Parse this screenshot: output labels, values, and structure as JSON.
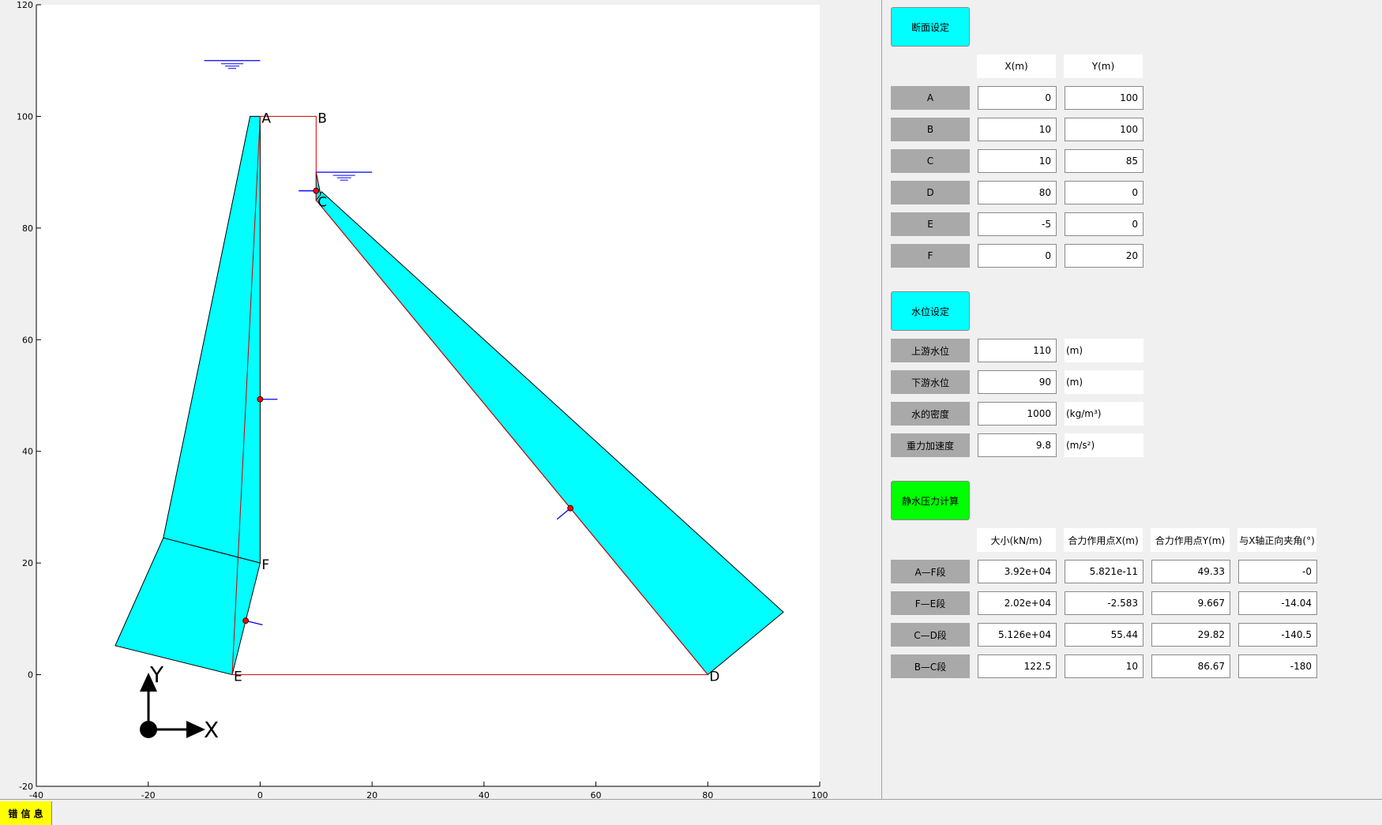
{
  "chart_data": {
    "type": "diagram",
    "xlim": [
      -40,
      100
    ],
    "ylim": [
      -20,
      120
    ],
    "x_ticks": [
      "-40",
      "-20",
      "0",
      "20",
      "40",
      "60",
      "80",
      "100"
    ],
    "y_ticks": [
      "-20",
      "0",
      "20",
      "40",
      "60",
      "80",
      "100",
      "120"
    ],
    "grid": false,
    "point_labels": [
      {
        "name": "A",
        "x": 0,
        "y": 100
      },
      {
        "name": "B",
        "x": 10,
        "y": 100
      },
      {
        "name": "C",
        "x": 10,
        "y": 85
      },
      {
        "name": "D",
        "x": 80,
        "y": 0
      },
      {
        "name": "E",
        "x": -5,
        "y": 0
      },
      {
        "name": "F",
        "x": 0,
        "y": 20
      }
    ],
    "outline": [
      [
        -5,
        0
      ],
      [
        80,
        0
      ],
      [
        10,
        85
      ],
      [
        10,
        100
      ],
      [
        0,
        100
      ]
    ],
    "pressure_polygons": [
      {
        "segment": "A—F",
        "points": [
          [
            -1.8,
            100
          ],
          [
            0,
            100
          ],
          [
            0,
            20
          ],
          [
            -17.3,
            24.5
          ]
        ]
      },
      {
        "segment": "F—E",
        "points": [
          [
            -17.3,
            24.5
          ],
          [
            0,
            20
          ],
          [
            -5,
            0
          ],
          [
            -25.9,
            5.2
          ]
        ]
      },
      {
        "segment": "C—D",
        "points": [
          [
            10,
            85
          ],
          [
            80,
            0
          ],
          [
            93.5,
            11.2
          ],
          [
            11,
            86.5
          ]
        ]
      },
      {
        "segment": "B—C",
        "points": [
          [
            10,
            90
          ],
          [
            10,
            85
          ],
          [
            10.8,
            86
          ]
        ]
      }
    ],
    "water_levels": [
      {
        "x_start": -10,
        "x_end": 0,
        "y": 110
      },
      {
        "x_start": 10,
        "x_end": 20,
        "y": 90
      }
    ],
    "resultants": [
      {
        "segment": "A—F",
        "x": 0,
        "y": 49.33,
        "angle": 0
      },
      {
        "segment": "F—E",
        "x": -2.583,
        "y": 9.667,
        "angle": -14.04
      },
      {
        "segment": "C—D",
        "x": 55.44,
        "y": 29.82,
        "angle": -140.5
      },
      {
        "segment": "B—C",
        "x": 10,
        "y": 86.67,
        "angle": -180
      }
    ],
    "axes_icon": {
      "x_label": "X",
      "y_label": "Y"
    }
  },
  "colors": {
    "pressure_fill": "#00ffff",
    "outline": "#cc0000",
    "water_line": "#0000ff",
    "resultant_point": "#ff0000",
    "section_button": "#00ffff",
    "calc_button": "#00ff00",
    "error_tab": "#ffff00"
  },
  "section": {
    "button": "断面设定",
    "col_x": "X(m)",
    "col_y": "Y(m)",
    "points": [
      {
        "label": "A",
        "x": "0",
        "y": "100"
      },
      {
        "label": "B",
        "x": "10",
        "y": "100"
      },
      {
        "label": "C",
        "x": "10",
        "y": "85"
      },
      {
        "label": "D",
        "x": "80",
        "y": "0"
      },
      {
        "label": "E",
        "x": "-5",
        "y": "0"
      },
      {
        "label": "F",
        "x": "0",
        "y": "20"
      }
    ]
  },
  "water": {
    "button": "水位设定",
    "rows": [
      {
        "label": "上游水位",
        "value": "110",
        "unit": "(m)"
      },
      {
        "label": "下游水位",
        "value": "90",
        "unit": "(m)"
      },
      {
        "label": "水的密度",
        "value": "1000",
        "unit": "(kg/m³)"
      },
      {
        "label": "重力加速度",
        "value": "9.8",
        "unit": "(m/s²)"
      }
    ]
  },
  "calc": {
    "button": "静水压力计算",
    "headers": [
      "大小(kN/m)",
      "合力作用点X(m)",
      "合力作用点Y(m)",
      "与X轴正向夹角(°)"
    ],
    "rows": [
      {
        "label": "A—F段",
        "values": [
          "3.92e+04",
          "5.821e-11",
          "49.33",
          "-0"
        ]
      },
      {
        "label": "F—E段",
        "values": [
          "2.02e+04",
          "-2.583",
          "9.667",
          "-14.04"
        ]
      },
      {
        "label": "C—D段",
        "values": [
          "5.126e+04",
          "55.44",
          "29.82",
          "-140.5"
        ]
      },
      {
        "label": "B—C段",
        "values": [
          "122.5",
          "10",
          "86.67",
          "-180"
        ]
      }
    ]
  },
  "footer": {
    "error_tab": "错 信 息"
  }
}
